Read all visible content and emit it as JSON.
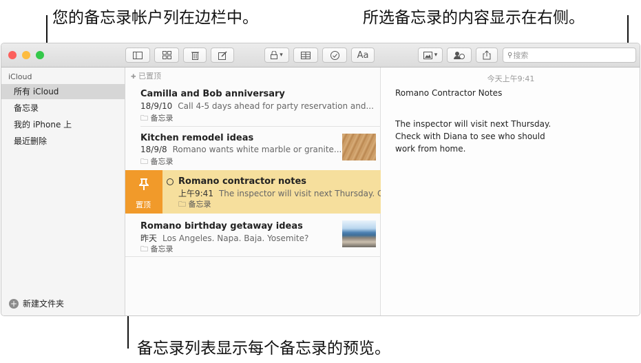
{
  "callouts": {
    "top_left": "您的备忘录帐户列在边栏中。",
    "top_right": "所选备忘录的内容显示在右侧。",
    "bottom": "备忘录列表显示每个备忘录的预览。"
  },
  "toolbar": {
    "format_label": "Aa",
    "search_placeholder": "搜索"
  },
  "sidebar": {
    "account": "iCloud",
    "items": [
      {
        "label": "所有 iCloud"
      },
      {
        "label": "备忘录"
      },
      {
        "label": "我的 iPhone 上"
      },
      {
        "label": "最近删除"
      }
    ],
    "new_folder": "新建文件夹"
  },
  "list": {
    "pinned_header": "已置顶",
    "pin_action_label": "置顶",
    "notes": [
      {
        "title": "Camilla and Bob anniversary",
        "date": "18/9/10",
        "preview": "Call 4-5 days ahead for party reservation and...",
        "folder": "备忘录"
      },
      {
        "title": "Kitchen remodel ideas",
        "date": "18/9/8",
        "preview": "Romano wants white marble or granite...",
        "folder": "备忘录"
      },
      {
        "title": "Romano contractor notes",
        "date": "上午9:41",
        "preview": "The inspector will visit next Thursday. Check",
        "folder": "备忘录"
      },
      {
        "title": "Romano birthday getaway ideas",
        "date": "昨天",
        "preview": "Los Angeles. Napa. Baja. Yosemite?",
        "folder": "备忘录"
      }
    ]
  },
  "detail": {
    "timestamp": "今天上午9:41",
    "title": "Romano Contractor Notes",
    "body": "The inspector will visit next Thursday. Check with Diana to see who should work from home."
  },
  "colors": {
    "pin_orange": "#f19a2a",
    "selected_note_bg": "#f6df9d",
    "close": "#fc605c",
    "minimize": "#fdbc40",
    "zoom": "#34c84a"
  }
}
